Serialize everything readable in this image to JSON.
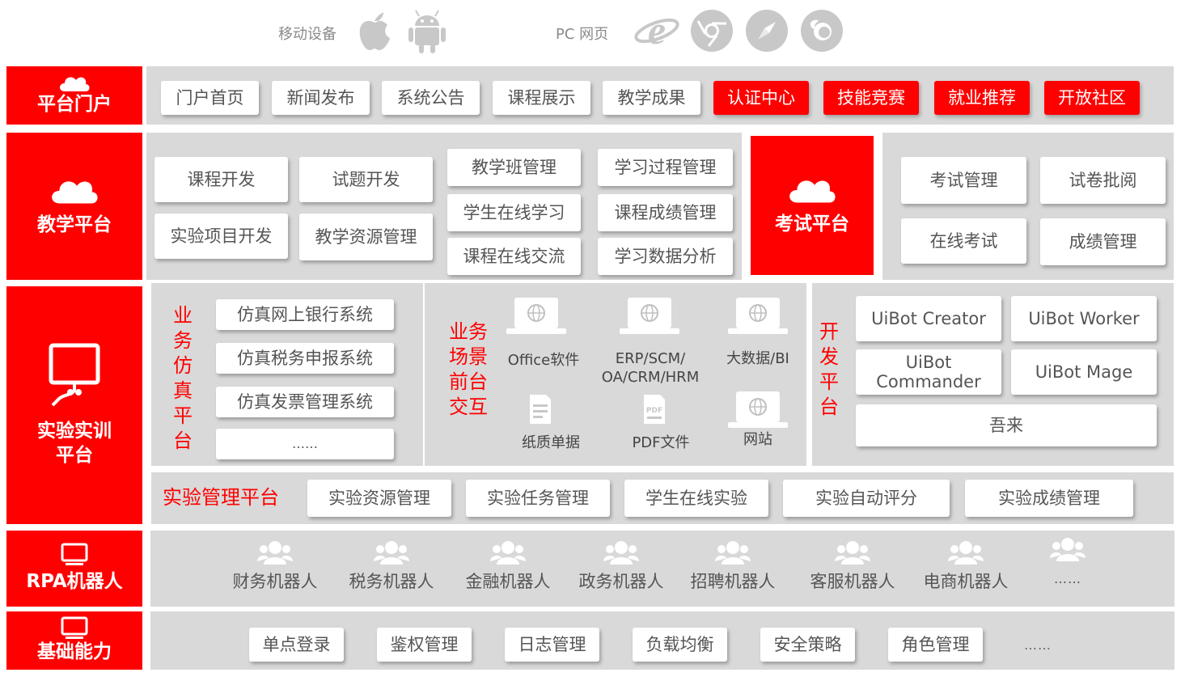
{
  "top": {
    "mobile_label": "移动设备",
    "pc_label": "PC 网页",
    "icons": [
      "apple-icon",
      "android-icon",
      "ie-icon",
      "chrome-icon",
      "safari-icon",
      "firefox-icon"
    ]
  },
  "portal": {
    "title": "平台门户",
    "items": [
      "门户首页",
      "新闻发布",
      "系统公告",
      "课程展示",
      "教学成果"
    ],
    "highlight_items": [
      "认证中心",
      "技能竞赛",
      "就业推荐",
      "开放社区"
    ]
  },
  "teaching": {
    "title": "教学平台",
    "items": [
      "课程开发",
      "试题开发",
      "实验项目开发",
      "教学资源管理",
      "教学班管理",
      "学习过程管理",
      "学生在线学习",
      "课程成绩管理",
      "课程在线交流",
      "学习数据分析"
    ]
  },
  "exam": {
    "title": "考试平台",
    "items": [
      "考试管理",
      "试卷批阅",
      "在线考试",
      "成绩管理"
    ]
  },
  "lab": {
    "title_line1": "实验实训",
    "title_line2": "平台",
    "sim": {
      "label_chars": [
        "业",
        "务",
        "仿",
        "真",
        "平",
        "台"
      ],
      "items": [
        "仿真网上银行系统",
        "仿真税务申报系统",
        "仿真发票管理系统",
        "……"
      ]
    },
    "scene": {
      "label_lines": [
        "业务",
        "场景",
        "前台",
        "交互"
      ],
      "items": [
        "Office软件",
        "ERP/SCM/",
        "OA/CRM/HRM",
        "大数据/BI",
        "纸质单据",
        "PDF文件",
        "网站"
      ]
    },
    "dev": {
      "label_chars": [
        "开",
        "发",
        "平",
        "台"
      ],
      "items": [
        "UiBot Creator",
        "UiBot Worker",
        "UiBot",
        "Commander",
        "UiBot Mage",
        "吾来"
      ]
    },
    "manage": {
      "title": "实验管理平台",
      "items": [
        "实验资源管理",
        "实验任务管理",
        "学生在线实验",
        "实验自动评分",
        "实验成绩管理"
      ]
    }
  },
  "rpa": {
    "title": "RPA机器人",
    "items": [
      "财务机器人",
      "税务机器人",
      "金融机器人",
      "政务机器人",
      "招聘机器人",
      "客服机器人",
      "电商机器人",
      "……"
    ]
  },
  "base": {
    "title": "基础能力",
    "items": [
      "单点登录",
      "鉴权管理",
      "日志管理",
      "负载均衡",
      "安全策略",
      "角色管理",
      "……"
    ]
  },
  "colors": {
    "accent": "#ff0000",
    "panel": "#d9d9d9",
    "text": "#555555"
  }
}
